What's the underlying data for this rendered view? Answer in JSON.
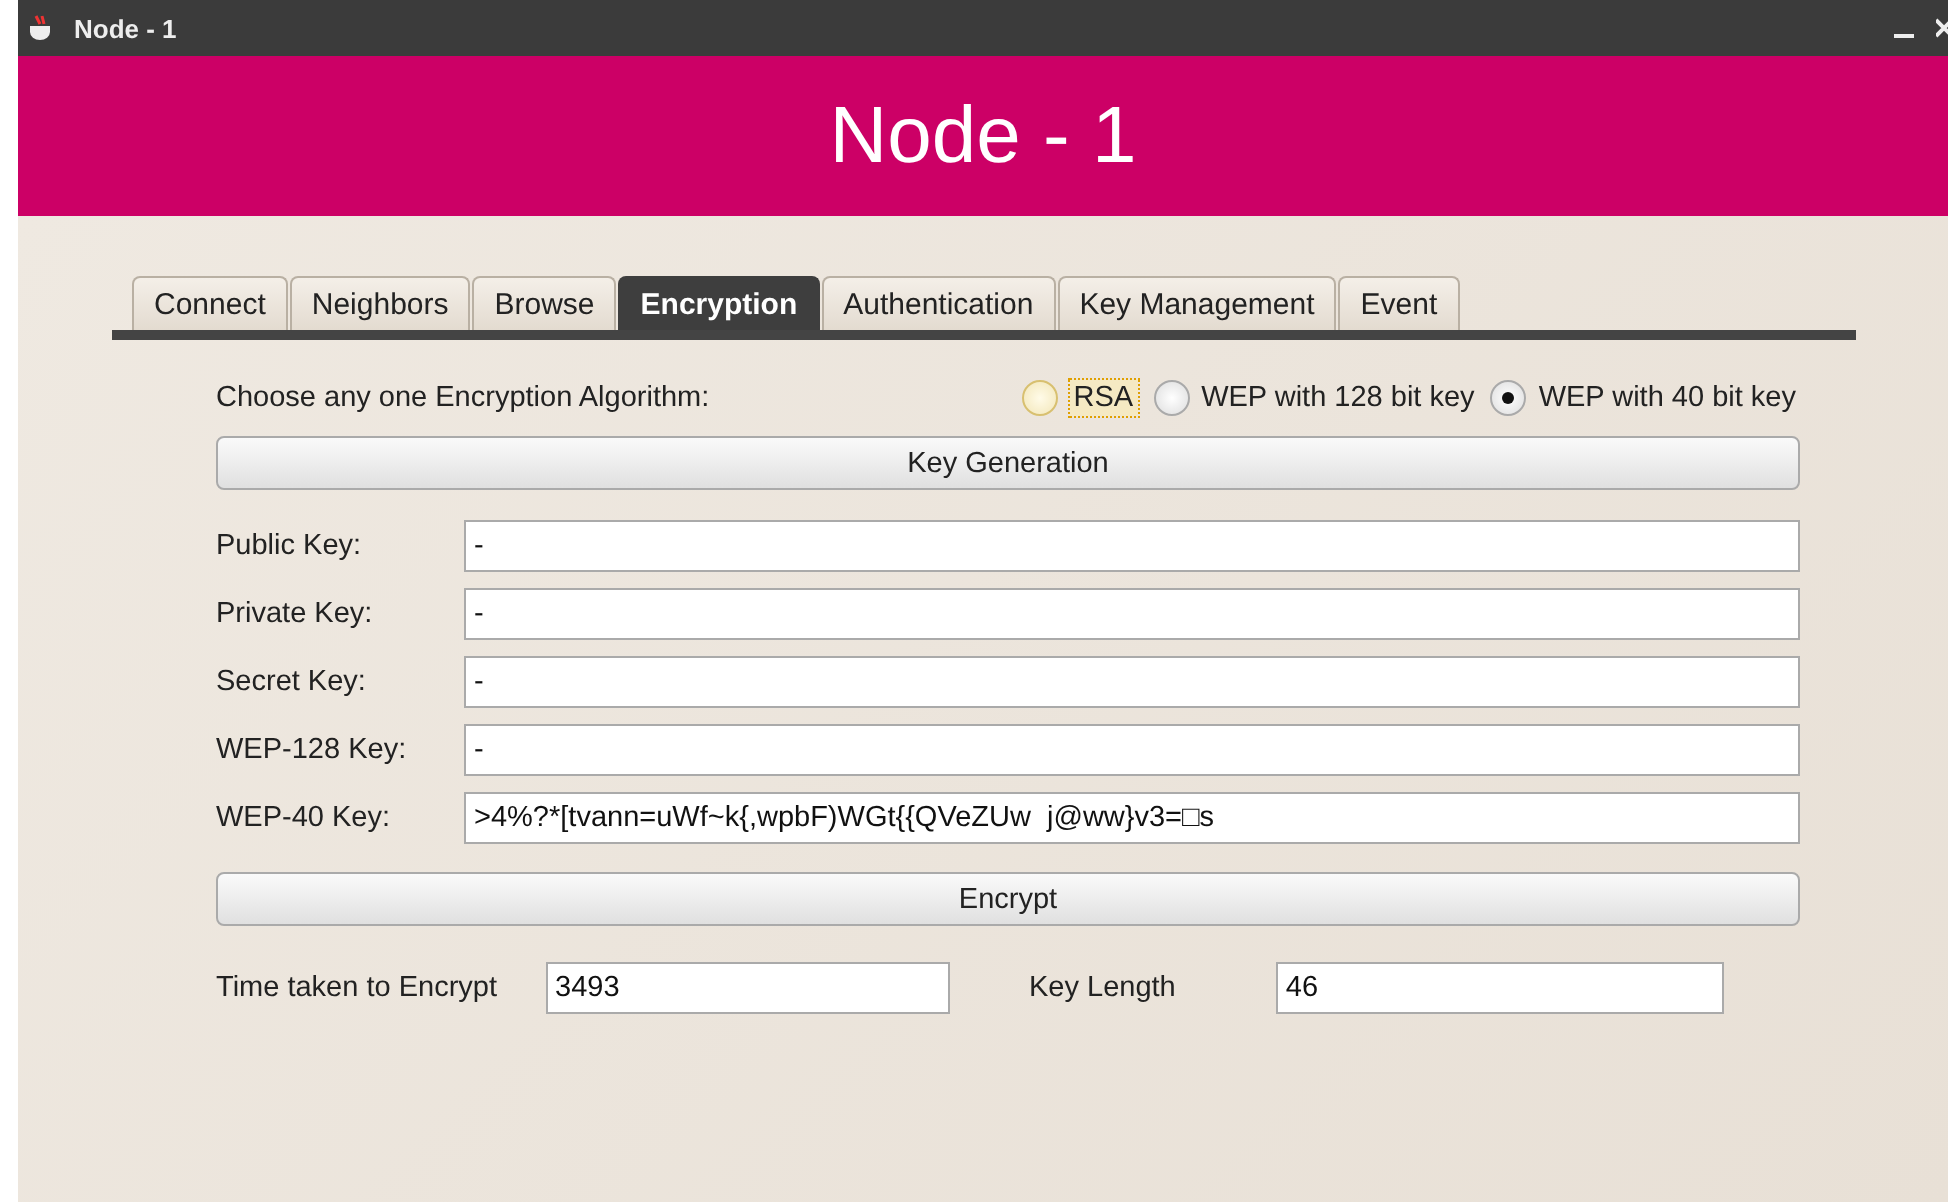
{
  "window": {
    "title": "Node - 1"
  },
  "banner": {
    "title": "Node - 1"
  },
  "tabs": [
    {
      "label": "Connect",
      "selected": false
    },
    {
      "label": "Neighbors",
      "selected": false
    },
    {
      "label": "Browse",
      "selected": false
    },
    {
      "label": "Encryption",
      "selected": true
    },
    {
      "label": "Authentication",
      "selected": false
    },
    {
      "label": "Key Management",
      "selected": false
    },
    {
      "label": "Event",
      "selected": false
    }
  ],
  "algorithm": {
    "label": "Choose any one Encryption Algorithm:",
    "options": [
      {
        "label": "RSA",
        "selected": false,
        "focused": true
      },
      {
        "label": "WEP with 128 bit key",
        "selected": false,
        "focused": false
      },
      {
        "label": "WEP with 40 bit key",
        "selected": true,
        "focused": false
      }
    ]
  },
  "key_generation_button": "Key Generation",
  "fields": [
    {
      "label": "Public Key:",
      "value": "-"
    },
    {
      "label": "Private Key:",
      "value": "-"
    },
    {
      "label": "Secret Key:",
      "value": "-"
    },
    {
      "label": "WEP-128 Key:",
      "value": "-"
    },
    {
      "label": "WEP-40 Key:",
      "value": ">4%?*[tvann=uWf~k{,wpbF)WGt{{QVeZUw  j@ww}v3=□s"
    }
  ],
  "encrypt_button": "Encrypt",
  "results": [
    {
      "label": "Time taken to Encrypt",
      "value": "3493"
    },
    {
      "label": "Key Length",
      "value": "46"
    }
  ]
}
